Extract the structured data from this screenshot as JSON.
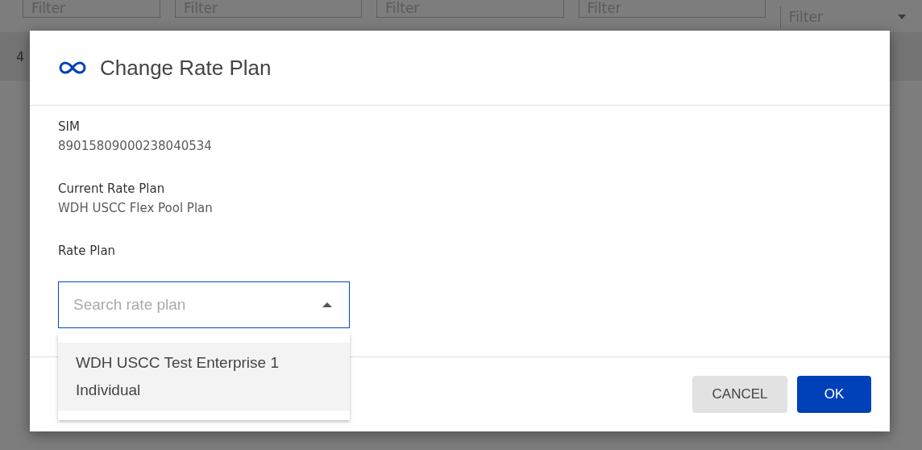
{
  "background": {
    "filters": [
      {
        "kind": "text",
        "placeholder": "Filter"
      },
      {
        "kind": "text",
        "placeholder": "Filter"
      },
      {
        "kind": "text",
        "placeholder": "Filter"
      },
      {
        "kind": "text",
        "placeholder": "Filter"
      },
      {
        "kind": "select",
        "placeholder": "Filter"
      }
    ],
    "row_cell": "4"
  },
  "dialog": {
    "title": "Change Rate Plan",
    "fields": [
      {
        "label": "SIM",
        "value": "89015809000238040534"
      },
      {
        "label": "Current Rate Plan",
        "value": "WDH USCC Flex Pool Plan"
      }
    ],
    "rate_plan": {
      "label": "Rate Plan",
      "placeholder": "Search rate plan",
      "expanded": true,
      "options": [
        {
          "label": "WDH USCC Test Enterprise 1 Individual",
          "highlighted": true
        }
      ]
    },
    "buttons": [
      {
        "kind": "secondary",
        "label": "CANCEL"
      },
      {
        "kind": "primary",
        "label": "OK"
      }
    ]
  }
}
